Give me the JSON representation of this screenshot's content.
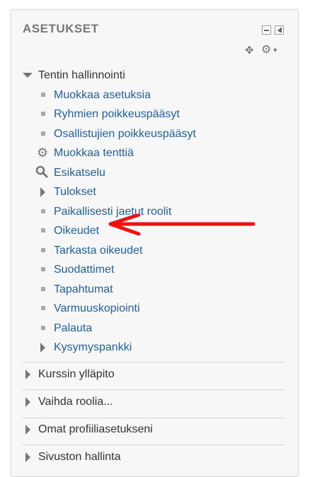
{
  "block": {
    "title": "ASETUKSET",
    "controls": {
      "minimize": "minimize",
      "dock": "dock"
    }
  },
  "tree": {
    "section_title": "Tentin hallinnointi",
    "items": [
      {
        "label": "Muokkaa asetuksia",
        "icon": "bullet"
      },
      {
        "label": "Ryhmien poikkeuspääsyt",
        "icon": "bullet"
      },
      {
        "label": "Osallistujien poikkeuspääsyt",
        "icon": "bullet"
      },
      {
        "label": "Muokkaa tenttiä",
        "icon": "gear-icon"
      },
      {
        "label": "Esikatselu",
        "icon": "magnifier-icon"
      },
      {
        "label": "Tulokset",
        "icon": "expand-triangle"
      },
      {
        "label": "Paikallisesti jaetut roolit",
        "icon": "bullet"
      },
      {
        "label": "Oikeudet",
        "icon": "bullet"
      },
      {
        "label": "Tarkasta oikeudet",
        "icon": "bullet"
      },
      {
        "label": "Suodattimet",
        "icon": "bullet"
      },
      {
        "label": "Tapahtumat",
        "icon": "bullet"
      },
      {
        "label": "Varmuuskopiointi",
        "icon": "bullet"
      },
      {
        "label": "Palauta",
        "icon": "bullet"
      },
      {
        "label": "Kysymyspankki",
        "icon": "expand-triangle"
      }
    ],
    "collapsed_sections": [
      {
        "label": "Kurssin ylläpito"
      },
      {
        "label": "Vaihda roolia..."
      },
      {
        "label": "Omat profiiliasetukseni"
      },
      {
        "label": "Sivuston hallinta"
      }
    ]
  },
  "colors": {
    "link": "#1f5f9e",
    "text": "#333333",
    "annotation_arrow": "#ee1111"
  }
}
